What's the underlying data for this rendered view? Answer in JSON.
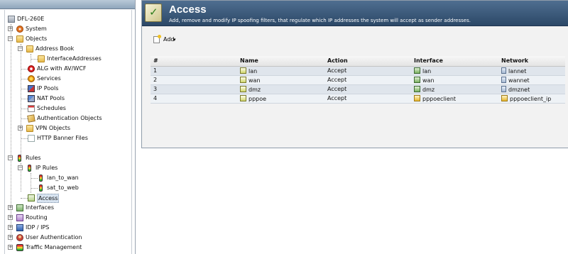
{
  "tree": {
    "root": "DFL-260E",
    "items": {
      "system": "System",
      "objects": "Objects",
      "address_book": "Address Book",
      "interface_addresses": "InterfaceAddresses",
      "alg": "ALG with AV/WCF",
      "services": "Services",
      "ip_pools": "IP Pools",
      "nat_pools": "NAT Pools",
      "schedules": "Schedules",
      "auth_objects": "Authentication Objects",
      "vpn_objects": "VPN Objects",
      "http_banner": "HTTP Banner Files",
      "rules": "Rules",
      "ip_rules": "IP Rules",
      "lan_to_wan": "lan_to_wan",
      "sat_to_web": "sat_to_web",
      "access": "Access",
      "interfaces": "Interfaces",
      "routing": "Routing",
      "idp_ips": "IDP / IPS",
      "user_auth": "User Authentication",
      "traffic_mgmt": "Traffic Management"
    },
    "selected": "access"
  },
  "header": {
    "title": "Access",
    "description": "Add, remove and modify IP spoofing filters, that regulate which IP addresses the system will accept as sender addresses."
  },
  "toolbar": {
    "add_label": "Add",
    "add_caret": "▾"
  },
  "table": {
    "columns": [
      "#",
      "Name",
      "Action",
      "Interface",
      "Network"
    ],
    "rows": [
      {
        "num": "1",
        "name": "lan",
        "action": "Accept",
        "interface": "lan",
        "network": "lannet"
      },
      {
        "num": "2",
        "name": "wan",
        "action": "Accept",
        "interface": "wan",
        "network": "wannet"
      },
      {
        "num": "3",
        "name": "dmz",
        "action": "Accept",
        "interface": "dmz",
        "network": "dmznet"
      },
      {
        "num": "4",
        "name": "pppoe",
        "action": "Accept",
        "interface": "pppoeclient",
        "network": "pppoeclient_ip"
      }
    ]
  },
  "colors": {
    "title_bar": "#3a5878",
    "row_odd": "#dfe5ec",
    "row_even": "#eef2f6"
  }
}
